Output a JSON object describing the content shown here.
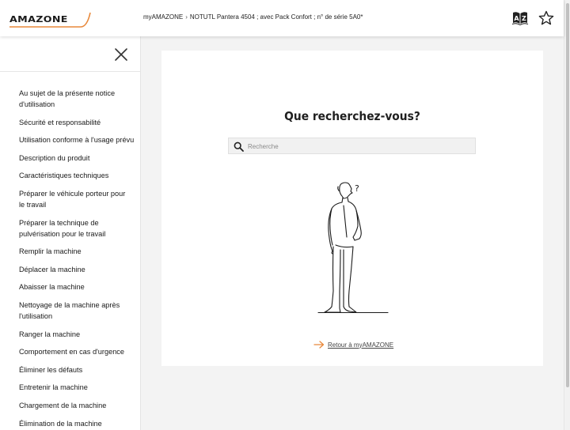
{
  "header": {
    "logo_text": "AMAZONE",
    "breadcrumb": {
      "home": "myAMAZONE",
      "separator": "›",
      "current": "NOTUTL Pantera 4504 ; avec Pack Confort ; n° de série 5A0*"
    }
  },
  "sidebar": {
    "items": [
      "Au sujet de la présente notice d'utilisation",
      "Sécurité et responsabilité",
      "Utilisation conforme à l'usage prévu",
      "Description du produit",
      "Caractéristiques techniques",
      "Préparer le véhicule porteur pour le travail",
      "Préparer la technique de pulvérisation pour le travail",
      "Remplir la machine",
      "Déplacer la machine",
      "Abaisser la machine",
      "Nettoyage de la machine après l'utilisation",
      "Ranger la machine",
      "Comportement en cas d'urgence",
      "Éliminer les défauts",
      "Entretenir la machine",
      "Chargement de la machine",
      "Élimination de la machine"
    ]
  },
  "main": {
    "title": "Que recherchez-vous?",
    "search_placeholder": "Recherche",
    "figure_mark": "?",
    "back_link": "Retour à myAMAZONE"
  },
  "colors": {
    "accent": "#e8883a",
    "text": "#1a1a1a",
    "background": "#f3f3f3"
  },
  "icons": {
    "logo": "amazone-swoosh-icon",
    "dictionary": "dictionary-icon",
    "favorite": "star-icon",
    "close": "close-icon",
    "search": "search-icon",
    "back": "arrow-right-icon"
  }
}
